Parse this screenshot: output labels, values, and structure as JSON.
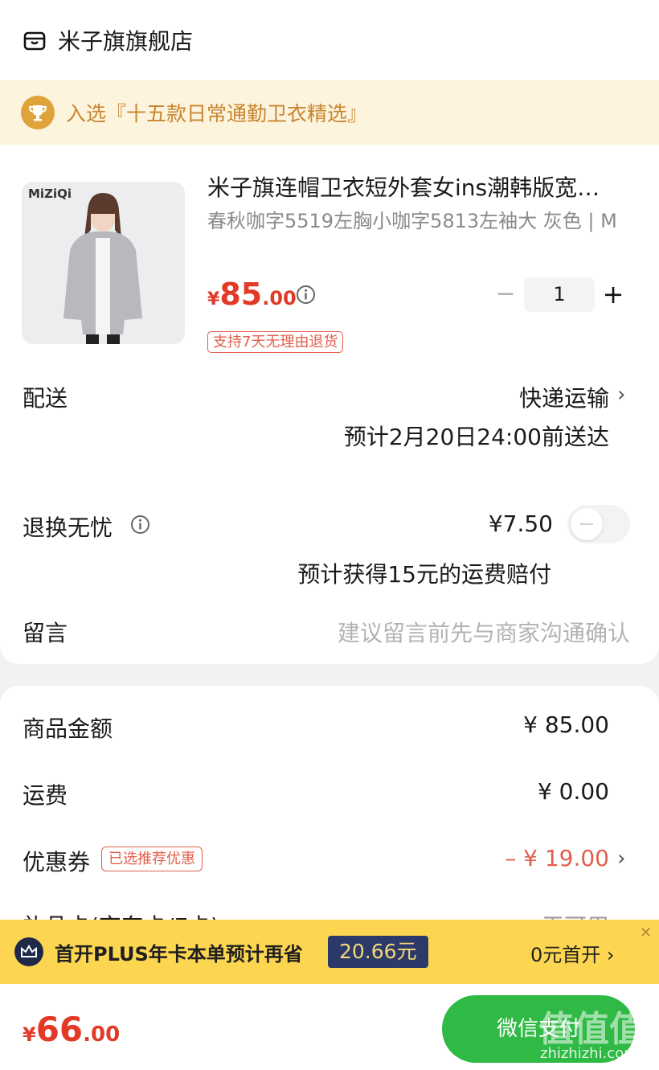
{
  "store": {
    "name": "米子旗旗舰店",
    "icon": "store-icon"
  },
  "award": {
    "text": "入选『十五款日常通勤卫衣精选』",
    "icon": "trophy-icon"
  },
  "product": {
    "image_logo": "MiZiQi",
    "title": "米子旗连帽卫衣短外套女ins潮韩版宽…",
    "spec": "春秋咖字5519左胸小咖字5813左袖大 灰色 | M",
    "price_symbol": "¥",
    "price_int": "85",
    "price_dec": ".00",
    "quantity": "1",
    "qty_minus": "−",
    "qty_plus": "+",
    "return_badge": "支持7天无理由退货"
  },
  "delivery": {
    "label": "配送",
    "method": "快递运输",
    "eta": "预计2月20日24:00前送达"
  },
  "worry_free": {
    "label": "退换无忧",
    "price": "¥7.50",
    "toggle_on": false,
    "compensation": "预计获得15元的运费赔付"
  },
  "remark": {
    "label": "留言",
    "placeholder": "建议留言前先与商家沟通确认"
  },
  "summary": {
    "goods_label": "商品金额",
    "goods_value": "¥ 85.00",
    "shipping_label": "运费",
    "shipping_value": "¥ 0.00",
    "coupon_label": "优惠券",
    "coupon_badge": "已选推荐优惠",
    "coupon_value": "– ¥ 19.00",
    "cutoff_label": "礼品卡(京东卡/E卡)",
    "cutoff_value": "无可用"
  },
  "plus_banner": {
    "text": "首开PLUS年卡本单预计再省",
    "amount": "20.66元",
    "cta": "0元首开 ›",
    "close": "✕"
  },
  "bottom": {
    "total_symbol": "¥",
    "total_int": "66",
    "total_dec": ".00",
    "pay_label": "微信支付"
  },
  "watermark": {
    "text": "值值值",
    "url": "zhizhizhi.com"
  },
  "colors": {
    "price_red": "#e23a27",
    "pay_green": "#2fb945",
    "plus_yellow": "#fdd651",
    "award_bg": "#fdf4de"
  }
}
